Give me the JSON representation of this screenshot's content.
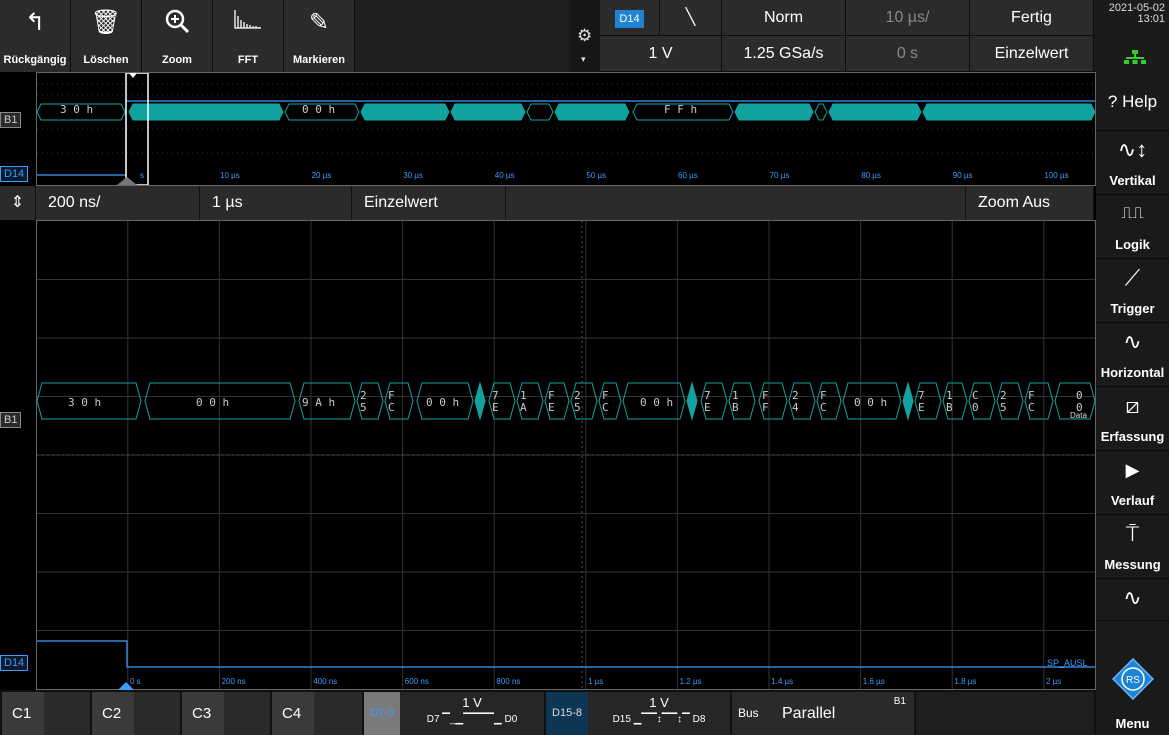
{
  "toolbar": {
    "buttons": [
      {
        "label": "Rückgängig",
        "icon": "undo-icon"
      },
      {
        "label": "Löschen",
        "icon": "trash-icon"
      },
      {
        "label": "Zoom",
        "icon": "zoom-icon"
      },
      {
        "label": "FFT",
        "icon": "fft-icon"
      },
      {
        "label": "Markieren",
        "icon": "pen-icon"
      }
    ]
  },
  "trigger": {
    "source": "D14",
    "mode": "Norm",
    "timebase": "10 µs/",
    "status": "Fertig",
    "level": "1 V",
    "samplerate": "1.25 GSa/s",
    "position": "0 s",
    "acquisition": "Einzelwert"
  },
  "datetime": {
    "date": "2021-05-02",
    "time": "13:01"
  },
  "overview": {
    "bus_label": "B1",
    "digital_label": "D14",
    "bus_values": [
      "30h",
      "00h",
      "FFh"
    ],
    "time_ticks": [
      "s",
      "10 µs",
      "20 µs",
      "30 µs",
      "40 µs",
      "50 µs",
      "60 µs",
      "70 µs",
      "80 µs",
      "90 µs",
      "100 µs"
    ]
  },
  "zoom": {
    "scale": "200 ns/",
    "position": "1 µs",
    "mode": "Einzelwert",
    "exit": "Zoom Aus"
  },
  "main": {
    "bus_label": "B1",
    "digital_label": "D14",
    "bus_values": [
      "30h",
      "00h",
      "9Ah",
      "25",
      "FC",
      "00h",
      "7E",
      "1A",
      "FE",
      "25",
      "FC",
      "00h",
      "7E",
      "1B",
      "FF",
      "24",
      "FC",
      "00h",
      "7E",
      "1B",
      "C0",
      "25",
      "FC",
      "00"
    ],
    "data_tag": "Data",
    "signal_name": "SP_AUSL",
    "time_ticks": [
      "0 s",
      "200 ns",
      "400 ns",
      "600 ns",
      "800 ns",
      "1 µs",
      "1.2 µs",
      "1.4 µs",
      "1.6 µs",
      "1.8 µs",
      "2 µs"
    ]
  },
  "sidebar": {
    "items": [
      {
        "label": "Help",
        "icon": "help-icon"
      },
      {
        "label": "Vertikal",
        "icon": "vertical-icon"
      },
      {
        "label": "Logik",
        "icon": "logic-icon"
      },
      {
        "label": "Trigger",
        "icon": "trigger-icon"
      },
      {
        "label": "Horizontal",
        "icon": "horizontal-icon"
      },
      {
        "label": "Erfassung",
        "icon": "acquire-icon"
      },
      {
        "label": "Verlauf",
        "icon": "play-icon"
      },
      {
        "label": "Messung",
        "icon": "measure-icon"
      },
      {
        "label": "Menu",
        "icon": "rs-logo-icon"
      }
    ]
  },
  "bottom": {
    "channels": [
      "C1",
      "C2",
      "C3",
      "C4"
    ],
    "d7_0": {
      "name": "D7-0",
      "level": "1 V",
      "pins": "D7 ▔_▁▔▔▔▔▁ D0"
    },
    "d15_8": {
      "name": "D15-8",
      "level": "1 V",
      "pins": "D15 ▁▔▔↕▔▔↕▔ D8"
    },
    "bus": {
      "label": "Bus",
      "type": "Parallel",
      "id": "B1"
    }
  },
  "colors": {
    "bus": "#12a3a0",
    "digital": "#3c9cff",
    "grid": "#3a3a3a",
    "accent": "#1f84d6"
  }
}
